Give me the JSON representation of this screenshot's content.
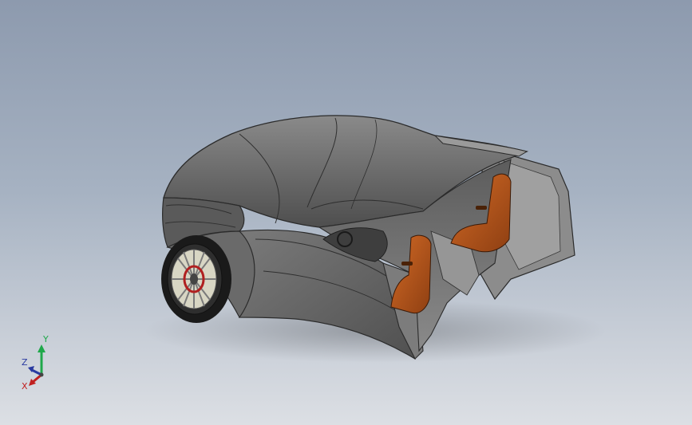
{
  "viewport": {
    "background_top": "#8d9aae",
    "background_bottom": "#dcdfe4"
  },
  "model": {
    "body_color": "#6f6f6f",
    "seat_color": "#b4561e",
    "rim_accent": "#b02020"
  },
  "triad": {
    "y_label": "Y",
    "z_label": "Z",
    "x_label": "X",
    "y_color": "#1fa84a",
    "z_color": "#2a3aa0",
    "x_color": "#c02020"
  }
}
